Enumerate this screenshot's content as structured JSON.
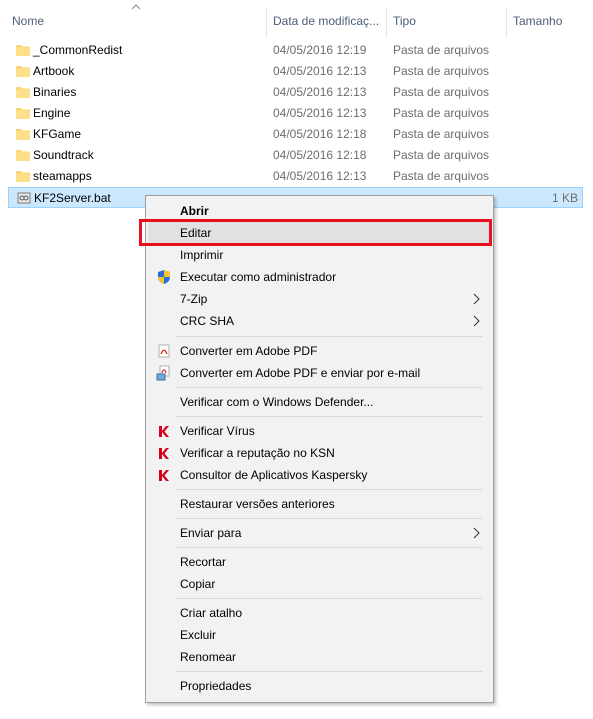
{
  "columns": {
    "name": "Nome",
    "date": "Data de modificaç...",
    "type": "Tipo",
    "size": "Tamanho"
  },
  "files": [
    {
      "name": "_CommonRedist",
      "date": "04/05/2016 12:19",
      "type": "Pasta de arquivos",
      "size": "",
      "icon": "folder-icon"
    },
    {
      "name": "Artbook",
      "date": "04/05/2016 12:13",
      "type": "Pasta de arquivos",
      "size": "",
      "icon": "folder-icon"
    },
    {
      "name": "Binaries",
      "date": "04/05/2016 12:13",
      "type": "Pasta de arquivos",
      "size": "",
      "icon": "folder-icon"
    },
    {
      "name": "Engine",
      "date": "04/05/2016 12:13",
      "type": "Pasta de arquivos",
      "size": "",
      "icon": "folder-icon"
    },
    {
      "name": "KFGame",
      "date": "04/05/2016 12:18",
      "type": "Pasta de arquivos",
      "size": "",
      "icon": "folder-icon"
    },
    {
      "name": "Soundtrack",
      "date": "04/05/2016 12:18",
      "type": "Pasta de arquivos",
      "size": "",
      "icon": "folder-icon"
    },
    {
      "name": "steamapps",
      "date": "04/05/2016 12:13",
      "type": "Pasta de arquivos",
      "size": "",
      "icon": "folder-icon"
    },
    {
      "name": "KF2Server.bat",
      "date": "",
      "type": "",
      "size": "1 KB",
      "icon": "batch-file-icon",
      "selected": true
    }
  ],
  "context_menu": {
    "items": [
      {
        "label": "Abrir",
        "bold": true
      },
      {
        "label": "Editar",
        "highlighted": true
      },
      {
        "label": "Imprimir"
      },
      {
        "label": "Executar como administrador",
        "icon": "uac-shield-icon"
      },
      {
        "label": "7-Zip",
        "submenu": true
      },
      {
        "label": "CRC SHA",
        "submenu": true
      },
      {
        "label": "Converter em Adobe PDF",
        "icon": "adobe-pdf-icon"
      },
      {
        "label": "Converter em Adobe PDF e enviar por e-mail",
        "icon": "adobe-pdf-email-icon"
      },
      {
        "label": "Verificar com o Windows Defender..."
      },
      {
        "label": "Verificar Vírus",
        "icon": "kaspersky-icon"
      },
      {
        "label": "Verificar a reputação no KSN",
        "icon": "kaspersky-icon"
      },
      {
        "label": "Consultor de Aplicativos Kaspersky",
        "icon": "kaspersky-icon"
      },
      {
        "label": "Restaurar versões anteriores"
      },
      {
        "label": "Enviar para",
        "submenu": true
      },
      {
        "label": "Recortar"
      },
      {
        "label": "Copiar"
      },
      {
        "label": "Criar atalho"
      },
      {
        "label": "Excluir"
      },
      {
        "label": "Renomear"
      },
      {
        "label": "Propriedades"
      }
    ]
  },
  "colors": {
    "highlight_border": "#e8101e",
    "selection_bg": "#cce8ff",
    "folder": "#f8d775"
  }
}
